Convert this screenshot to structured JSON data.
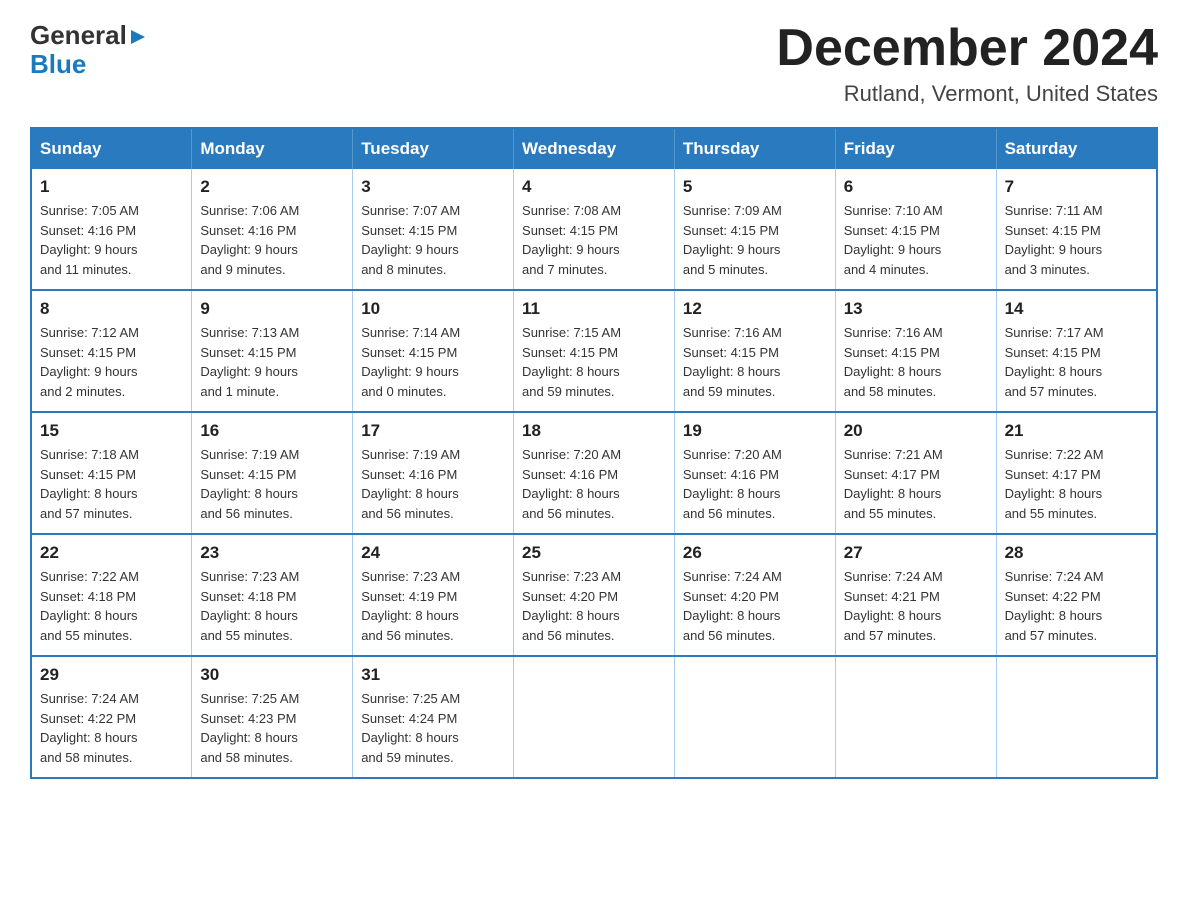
{
  "header": {
    "logo_general": "General",
    "logo_blue": "Blue",
    "month_title": "December 2024",
    "location": "Rutland, Vermont, United States"
  },
  "days_of_week": [
    "Sunday",
    "Monday",
    "Tuesday",
    "Wednesday",
    "Thursday",
    "Friday",
    "Saturday"
  ],
  "weeks": [
    [
      {
        "day": "1",
        "info": "Sunrise: 7:05 AM\nSunset: 4:16 PM\nDaylight: 9 hours\nand 11 minutes."
      },
      {
        "day": "2",
        "info": "Sunrise: 7:06 AM\nSunset: 4:16 PM\nDaylight: 9 hours\nand 9 minutes."
      },
      {
        "day": "3",
        "info": "Sunrise: 7:07 AM\nSunset: 4:15 PM\nDaylight: 9 hours\nand 8 minutes."
      },
      {
        "day": "4",
        "info": "Sunrise: 7:08 AM\nSunset: 4:15 PM\nDaylight: 9 hours\nand 7 minutes."
      },
      {
        "day": "5",
        "info": "Sunrise: 7:09 AM\nSunset: 4:15 PM\nDaylight: 9 hours\nand 5 minutes."
      },
      {
        "day": "6",
        "info": "Sunrise: 7:10 AM\nSunset: 4:15 PM\nDaylight: 9 hours\nand 4 minutes."
      },
      {
        "day": "7",
        "info": "Sunrise: 7:11 AM\nSunset: 4:15 PM\nDaylight: 9 hours\nand 3 minutes."
      }
    ],
    [
      {
        "day": "8",
        "info": "Sunrise: 7:12 AM\nSunset: 4:15 PM\nDaylight: 9 hours\nand 2 minutes."
      },
      {
        "day": "9",
        "info": "Sunrise: 7:13 AM\nSunset: 4:15 PM\nDaylight: 9 hours\nand 1 minute."
      },
      {
        "day": "10",
        "info": "Sunrise: 7:14 AM\nSunset: 4:15 PM\nDaylight: 9 hours\nand 0 minutes."
      },
      {
        "day": "11",
        "info": "Sunrise: 7:15 AM\nSunset: 4:15 PM\nDaylight: 8 hours\nand 59 minutes."
      },
      {
        "day": "12",
        "info": "Sunrise: 7:16 AM\nSunset: 4:15 PM\nDaylight: 8 hours\nand 59 minutes."
      },
      {
        "day": "13",
        "info": "Sunrise: 7:16 AM\nSunset: 4:15 PM\nDaylight: 8 hours\nand 58 minutes."
      },
      {
        "day": "14",
        "info": "Sunrise: 7:17 AM\nSunset: 4:15 PM\nDaylight: 8 hours\nand 57 minutes."
      }
    ],
    [
      {
        "day": "15",
        "info": "Sunrise: 7:18 AM\nSunset: 4:15 PM\nDaylight: 8 hours\nand 57 minutes."
      },
      {
        "day": "16",
        "info": "Sunrise: 7:19 AM\nSunset: 4:15 PM\nDaylight: 8 hours\nand 56 minutes."
      },
      {
        "day": "17",
        "info": "Sunrise: 7:19 AM\nSunset: 4:16 PM\nDaylight: 8 hours\nand 56 minutes."
      },
      {
        "day": "18",
        "info": "Sunrise: 7:20 AM\nSunset: 4:16 PM\nDaylight: 8 hours\nand 56 minutes."
      },
      {
        "day": "19",
        "info": "Sunrise: 7:20 AM\nSunset: 4:16 PM\nDaylight: 8 hours\nand 56 minutes."
      },
      {
        "day": "20",
        "info": "Sunrise: 7:21 AM\nSunset: 4:17 PM\nDaylight: 8 hours\nand 55 minutes."
      },
      {
        "day": "21",
        "info": "Sunrise: 7:22 AM\nSunset: 4:17 PM\nDaylight: 8 hours\nand 55 minutes."
      }
    ],
    [
      {
        "day": "22",
        "info": "Sunrise: 7:22 AM\nSunset: 4:18 PM\nDaylight: 8 hours\nand 55 minutes."
      },
      {
        "day": "23",
        "info": "Sunrise: 7:23 AM\nSunset: 4:18 PM\nDaylight: 8 hours\nand 55 minutes."
      },
      {
        "day": "24",
        "info": "Sunrise: 7:23 AM\nSunset: 4:19 PM\nDaylight: 8 hours\nand 56 minutes."
      },
      {
        "day": "25",
        "info": "Sunrise: 7:23 AM\nSunset: 4:20 PM\nDaylight: 8 hours\nand 56 minutes."
      },
      {
        "day": "26",
        "info": "Sunrise: 7:24 AM\nSunset: 4:20 PM\nDaylight: 8 hours\nand 56 minutes."
      },
      {
        "day": "27",
        "info": "Sunrise: 7:24 AM\nSunset: 4:21 PM\nDaylight: 8 hours\nand 57 minutes."
      },
      {
        "day": "28",
        "info": "Sunrise: 7:24 AM\nSunset: 4:22 PM\nDaylight: 8 hours\nand 57 minutes."
      }
    ],
    [
      {
        "day": "29",
        "info": "Sunrise: 7:24 AM\nSunset: 4:22 PM\nDaylight: 8 hours\nand 58 minutes."
      },
      {
        "day": "30",
        "info": "Sunrise: 7:25 AM\nSunset: 4:23 PM\nDaylight: 8 hours\nand 58 minutes."
      },
      {
        "day": "31",
        "info": "Sunrise: 7:25 AM\nSunset: 4:24 PM\nDaylight: 8 hours\nand 59 minutes."
      },
      {
        "day": "",
        "info": ""
      },
      {
        "day": "",
        "info": ""
      },
      {
        "day": "",
        "info": ""
      },
      {
        "day": "",
        "info": ""
      }
    ]
  ]
}
